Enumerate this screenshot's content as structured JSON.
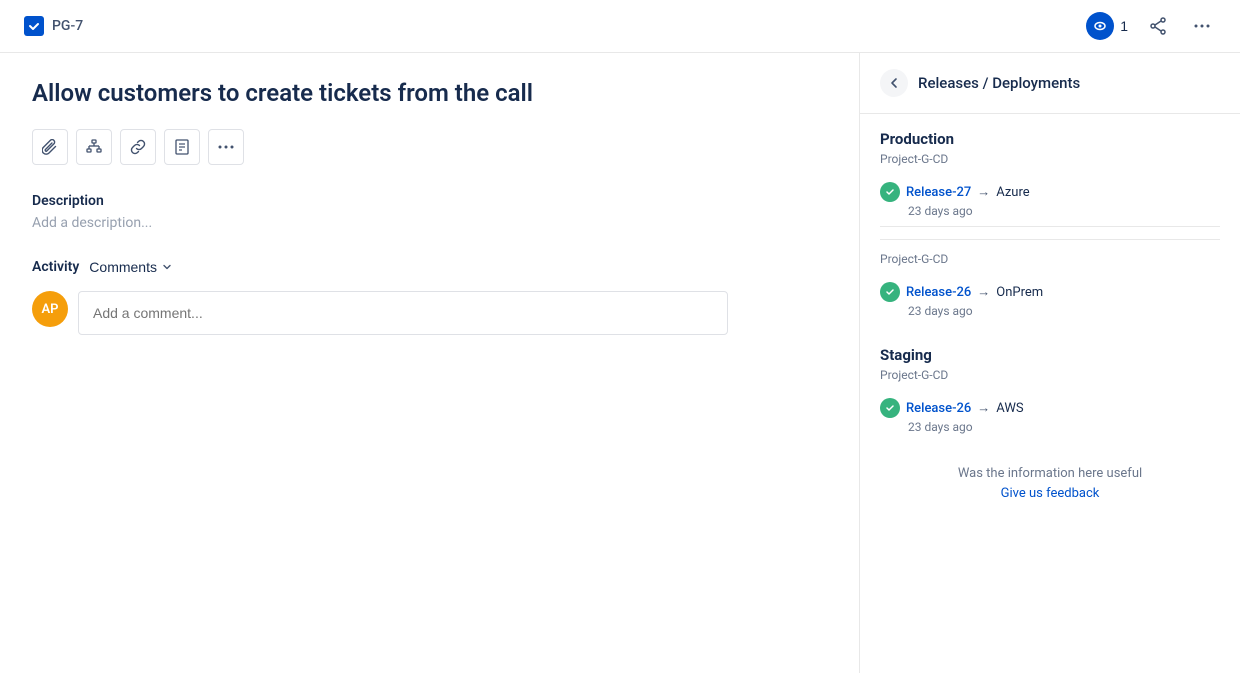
{
  "header": {
    "ticket_id": "PG-7",
    "watch_count": "1",
    "watch_icon": "●",
    "share_icon": "⎘",
    "more_icon": "⋯"
  },
  "issue": {
    "title": "Allow customers to create tickets from the call"
  },
  "toolbar": {
    "attach_label": "📎",
    "diagram_label": "⎋",
    "link_label": "🔗",
    "note_label": "📋",
    "more_label": "•••"
  },
  "description": {
    "label": "Description",
    "placeholder": "Add a description..."
  },
  "activity": {
    "label": "Activity",
    "filter_label": "Comments",
    "comment_placeholder": "Add a comment...",
    "avatar_initials": "AP"
  },
  "releases_panel": {
    "back_icon": "←",
    "title": "Releases / Deployments",
    "environments": [
      {
        "name": "Production",
        "entries": [
          {
            "project": "Project-G-CD",
            "release": "Release-27",
            "target": "Azure",
            "time": "23 days ago"
          },
          {
            "project": "Project-G-CD",
            "release": "Release-26",
            "target": "OnPrem",
            "time": "23 days ago"
          }
        ]
      },
      {
        "name": "Staging",
        "entries": [
          {
            "project": "Project-G-CD",
            "release": "Release-26",
            "target": "AWS",
            "time": "23 days ago"
          }
        ]
      }
    ],
    "feedback_text": "Was the information here useful",
    "feedback_link": "Give us feedback"
  }
}
